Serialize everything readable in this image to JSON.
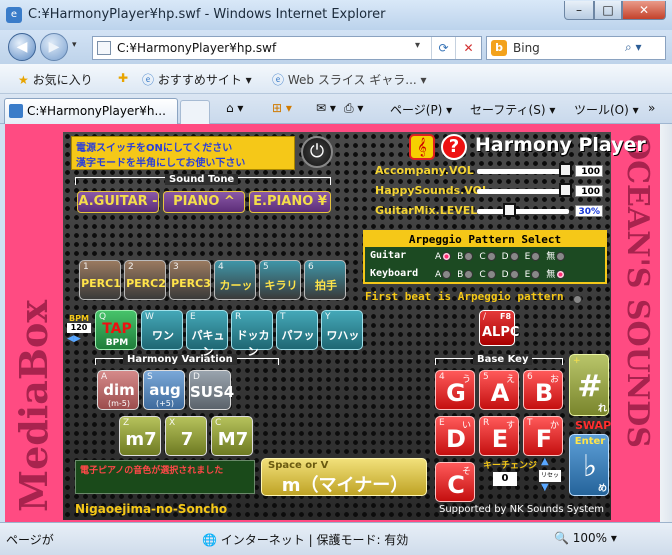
{
  "window": {
    "title": "C:¥HarmonyPlayer¥hp.swf - Windows Internet Explorer"
  },
  "address": {
    "url": "C:¥HarmonyPlayer¥hp.swf"
  },
  "search": {
    "placeholder": "Bing"
  },
  "favorites": {
    "fav_label": "お気に入り",
    "suggested": "おすすめサイト ▾",
    "webslice": "Web スライス ギャラ... ▾"
  },
  "tab": {
    "title": "C:¥HarmonyPlayer¥h..."
  },
  "commands": {
    "page": "ページ(P) ▾",
    "safety": "セーフティ(S) ▾",
    "tools": "ツール(O) ▾"
  },
  "status": {
    "left": "ページが",
    "zone": "インターネット | 保護モード: 有効",
    "zoom": "100%"
  },
  "app": {
    "brand_left": "MediaBox",
    "brand_right": "OCEAN'S SOUNDS",
    "title": "Harmony Player",
    "notice_line1": "電源スイッチをONにしてください",
    "notice_line2": "漢字モードを半角にしてお使い下さい",
    "sound_tone_label": "Sound Tone",
    "tones": [
      "A.GUITAR -",
      "PIANO ^",
      "E.PIANO ¥"
    ],
    "sliders": [
      {
        "label": "Accompany.VOL",
        "value": "100",
        "level": 1.0
      },
      {
        "label": "HappySounds.VOL",
        "value": "100",
        "level": 1.0
      },
      {
        "label": "GuitarMix.LEVEL",
        "value": "30%",
        "level": 0.3
      }
    ],
    "arpeggio_title": "Arpeggio Pattern Select",
    "arpeggio_rows": [
      {
        "label": "Guitar",
        "options": [
          "A",
          "B",
          "C",
          "D",
          "E",
          "無"
        ],
        "selected": 0
      },
      {
        "label": "Keyboard",
        "options": [
          "A",
          "B",
          "C",
          "D",
          "E",
          "無"
        ],
        "selected": 5
      }
    ],
    "first_beat": "First beat is Arpeggio pattern",
    "alpc": {
      "key": "/",
      "f8": "F8",
      "label": "ALPC"
    },
    "perc": [
      {
        "key": "1",
        "label": "PERC1"
      },
      {
        "key": "2",
        "label": "PERC2"
      },
      {
        "key": "3",
        "label": "PERC3"
      },
      {
        "key": "4",
        "label": "カーッ"
      },
      {
        "key": "5",
        "label": "キラリ"
      },
      {
        "key": "6",
        "label": "拍手"
      }
    ],
    "bpm_label": "BPM",
    "bpm_value": "120",
    "tap": {
      "key": "Q",
      "label": "TAP",
      "sub": "BPM"
    },
    "voices": [
      {
        "key": "W",
        "label": "ワン"
      },
      {
        "key": "E",
        "label": "パキュン"
      },
      {
        "key": "R",
        "label": "ドッカン"
      },
      {
        "key": "T",
        "label": "パフッ"
      },
      {
        "key": "Y",
        "label": "ワハッ"
      }
    ],
    "harmony_variation_label": "Harmony Variation",
    "harmony": [
      {
        "key": "A",
        "label": "dim",
        "sub": "(m-5)"
      },
      {
        "key": "S",
        "label": "aug",
        "sub": "(+5)"
      },
      {
        "key": "D",
        "label": "SUS4",
        "sub": ""
      },
      {
        "key": "Z",
        "label": "m7",
        "sub": ""
      },
      {
        "key": "X",
        "label": "7",
        "sub": ""
      },
      {
        "key": "C",
        "label": "M7",
        "sub": ""
      }
    ],
    "message": "電子ピアノの音色が選択されました",
    "minor_key": {
      "hint": "Space  or  V",
      "label": "m（マイナー）"
    },
    "base_key_label": "Base Key",
    "base_keys": [
      {
        "key": "4",
        "kana": "う",
        "label": "G"
      },
      {
        "key": "5",
        "kana": "え",
        "label": "A"
      },
      {
        "key": "6",
        "kana": "お",
        "label": "B"
      },
      {
        "key": "E",
        "kana": "い",
        "label": "D"
      },
      {
        "key": "R",
        "kana": "す",
        "label": "E"
      },
      {
        "key": "T",
        "kana": "か",
        "label": "F"
      },
      {
        "key": "",
        "kana": "そ",
        "label": "C"
      }
    ],
    "sharp": {
      "key": "+",
      "label": "#",
      "kana": "れ"
    },
    "swap": "SWAP",
    "flat": {
      "key": "Enter",
      "label": "♭",
      "kana": "め"
    },
    "key_change_label": "キーチェンジ",
    "key_change_value": "0",
    "key_reset": "リセット",
    "footer_left": "Nigaoejima-no-Soncho",
    "footer_right": "Supported by NK Sounds System"
  }
}
